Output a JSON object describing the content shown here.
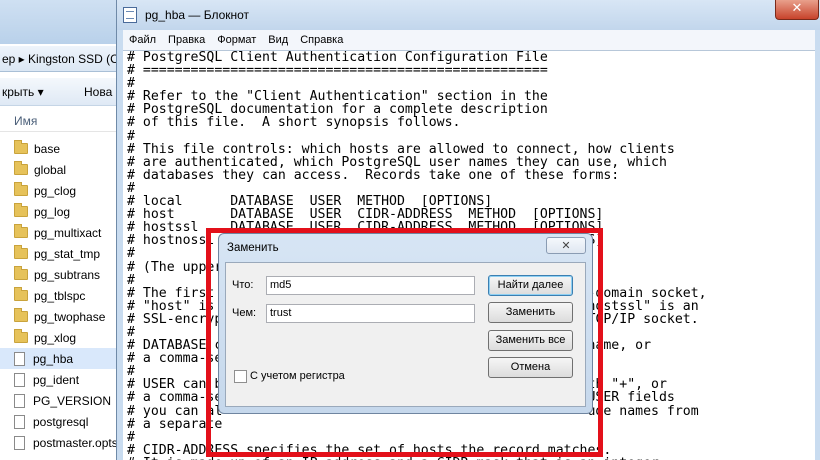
{
  "explorer": {
    "address": "ер ▸ Kingston SSD (C",
    "toolbar": {
      "organize": "крыть ▾",
      "new": "Нова"
    },
    "column_header": "Имя",
    "items": [
      {
        "name": "base",
        "type": "folder"
      },
      {
        "name": "global",
        "type": "folder"
      },
      {
        "name": "pg_clog",
        "type": "folder"
      },
      {
        "name": "pg_log",
        "type": "folder"
      },
      {
        "name": "pg_multixact",
        "type": "folder"
      },
      {
        "name": "pg_stat_tmp",
        "type": "folder"
      },
      {
        "name": "pg_subtrans",
        "type": "folder"
      },
      {
        "name": "pg_tblspc",
        "type": "folder"
      },
      {
        "name": "pg_twophase",
        "type": "folder"
      },
      {
        "name": "pg_xlog",
        "type": "folder"
      },
      {
        "name": "pg_hba",
        "type": "file",
        "selected": true
      },
      {
        "name": "pg_ident",
        "type": "file"
      },
      {
        "name": "PG_VERSION",
        "type": "file"
      },
      {
        "name": "postgresql",
        "type": "file"
      },
      {
        "name": "postmaster.opts",
        "type": "file"
      }
    ]
  },
  "notepad": {
    "title": "pg_hba — Блокнот",
    "close_symbol": "✕",
    "menu": [
      "Файл",
      "Правка",
      "Формат",
      "Вид",
      "Справка"
    ],
    "content": "# PostgreSQL Client Authentication Configuration File\n# ===================================================\n#\n# Refer to the \"Client Authentication\" section in the\n# PostgreSQL documentation for a complete description\n# of this file.  A short synopsis follows.\n#\n# This file controls: which hosts are allowed to connect, how clients\n# are authenticated, which PostgreSQL user names they can use, which\n# databases they can access.  Records take one of these forms:\n#\n# local      DATABASE  USER  METHOD  [OPTIONS]\n# host       DATABASE  USER  CIDR-ADDRESS  METHOD  [OPTIONS]\n# hostssl    DATABASE  USER  CIDR-ADDRESS  METHOD  [OPTIONS]\n# hostnossl  DATABASE  USER  CIDR-ADDRESS  METHOD  [OPTIONS]\n#\n# (The upper\n#\n# The first                                              x-domain socket,\n# \"host\" is                                              \"hostssl\" is an\n# SSL-encryp                                              TCP/IP socket.\n#\n# DATABASE c                                              name, or\n# a comma-se\n#\n# USER can b                                              th \"+\", or\n# a comma-se                                              USER fields\n# you can al                                              ude names from\n# a separate\n#\n# CIDR-ADDRESS specifies the set of hosts the record matches.\n# It is made up of an IP address and a CIDR mask that is an integer"
  },
  "dialog": {
    "title": "Заменить",
    "close_symbol": "✕",
    "find_label": "Что:",
    "find_value": "md5",
    "replace_label": "Чем:",
    "replace_value": "trust",
    "match_case_label": "С учетом регистра",
    "match_case_checked": false,
    "buttons": {
      "find_next": "Найти далее",
      "replace": "Заменить",
      "replace_all": "Заменить все",
      "cancel": "Отмена"
    }
  },
  "highlight_color": "#e3101a"
}
